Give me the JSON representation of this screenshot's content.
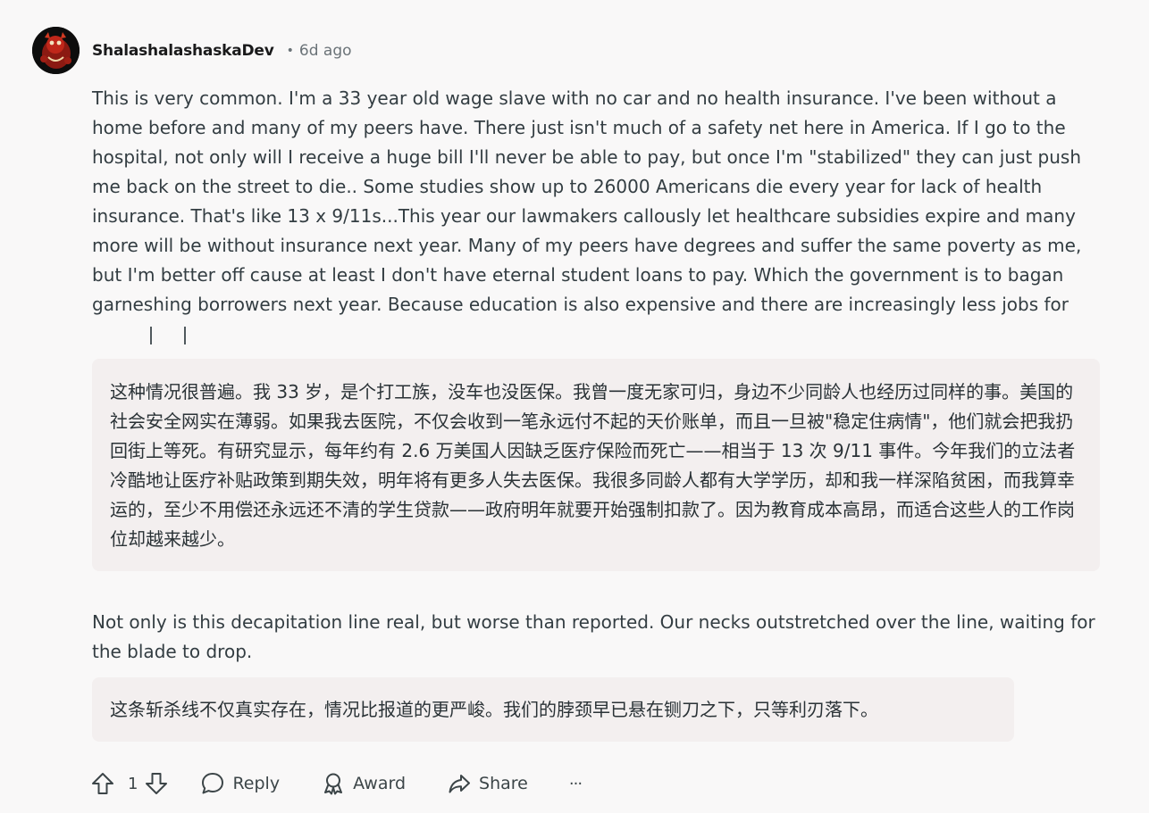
{
  "comment": {
    "username": "ShalashalashaskaDev",
    "separator": "•",
    "timestamp": "6d ago",
    "paragraph_1": "This is very common. I'm a 33 year old wage slave with no car and no health insurance. I've been without a home before and many of my peers have. There just isn't much of a safety net here in America. If I go to the hospital, not only will I receive a huge bill I'll never be able to pay, but once I'm \"stabilized\" they can just push me back on the street to die.. Some studies show up to 26000 Americans die every year for lack of health insurance. That's like 13 x 9/11s...This year our lawmakers callously let healthcare subsidies expire and many more will be without insurance next year. Many of my peers have degrees and suffer the same poverty as me, but I'm better off cause at least I don't have eternal student loans to pay. Which the government is to bagan garneshing borrowers next year. Because education is also expensive and there are increasingly less jobs for",
    "translation_1": "这种情况很普遍。我 33 岁，是个打工族，没车也没医保。我曾一度无家可归，身边不少同龄人也经历过同样的事。美国的社会安全网实在薄弱。如果我去医院，不仅会收到一笔永远付不起的天价账单，而且一旦被\"稳定住病情\"，他们就会把我扔回街上等死。有研究显示，每年约有 2.6 万美国人因缺乏医疗保险而死亡——相当于 13 次 9/11 事件。今年我们的立法者冷酷地让医疗补贴政策到期失效，明年将有更多人失去医保。我很多同龄人都有大学学历，却和我一样深陷贫困，而我算幸运的，至少不用偿还永远还不清的学生贷款——政府明年就要开始强制扣款了。因为教育成本高昂，而适合这些人的工作岗位却越来越少。",
    "paragraph_2": "Not only is this decapitation line real, but worse than reported. Our necks outstretched over the line, waiting for the blade to drop.",
    "translation_2": "这条斩杀线不仅真实存在，情况比报道的更严峻。我们的脖颈早已悬在铡刀之下，只等利刃落下。"
  },
  "actions": {
    "vote_count": "1",
    "reply_label": "Reply",
    "award_label": "Award",
    "share_label": "Share",
    "more_label": "···"
  },
  "icons": {
    "upvote": "arrow-up-icon",
    "downvote": "arrow-down-icon",
    "reply": "speech-bubble-icon",
    "award": "award-ribbon-icon",
    "share": "share-arrow-icon",
    "more": "ellipsis-icon"
  },
  "colors": {
    "background": "#f9f8f8",
    "translation_bg": "#f3efef",
    "text": "#333d42",
    "meta": "#6b7378"
  }
}
